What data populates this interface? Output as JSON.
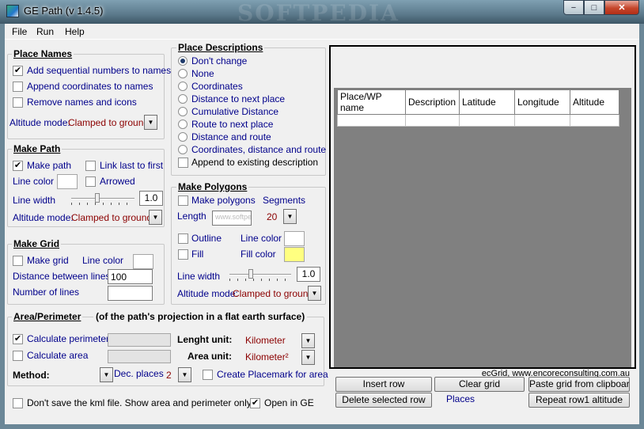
{
  "window": {
    "title": "GE Path (v 1.4.5)",
    "watermark": "SOFTPEDIA",
    "min": "−",
    "max": "□",
    "close": "✕"
  },
  "menu": [
    "File",
    "Run",
    "Help"
  ],
  "place_names": {
    "title": "Place Names",
    "sequential": "Add sequential numbers to names",
    "append_coords": "Append coordinates to names",
    "remove": "Remove names and icons",
    "alt_label": "Altitude mode:",
    "alt_value": "Clamped to ground"
  },
  "make_path": {
    "title": "Make Path",
    "make_path": "Make path",
    "link_last": "Link last to first",
    "line_color": "Line color",
    "arrowed": "Arrowed",
    "line_width": "Line width",
    "width_value": "1.0",
    "alt_label": "Altitude mode:",
    "alt_value": "Clamped to ground"
  },
  "make_grid": {
    "title": "Make Grid",
    "make_grid": "Make grid",
    "line_color": "Line color",
    "distance": "Distance between lines",
    "distance_value": "100",
    "number": "Number of  lines"
  },
  "area": {
    "title": "Area/Perimeter",
    "subtitle": "(of the path's projection in a flat earth surface)",
    "calc_perimeter": "Calculate perimeter",
    "calc_area": "Calculate area",
    "length_unit_label": "Lenght unit:",
    "length_unit": "Kilometer",
    "area_unit_label": "Area unit:",
    "area_unit": "Kilometer²",
    "method": "Method:",
    "dec_places": "Dec. places",
    "dec_value": "2",
    "create_placemark": "Create Placemark for area"
  },
  "bottom": {
    "dont_save": "Don't save the kml file. Show area and perimeter only",
    "open_ge": "Open in GE"
  },
  "place_desc": {
    "title": "Place Descriptions",
    "options": [
      "Don't change",
      "None",
      "Coordinates",
      "Distance to next place",
      "Cumulative Distance",
      "Route to next place",
      "Distance and route",
      "Coordinates, distance and route"
    ],
    "append": "Append to existing description"
  },
  "make_polygons": {
    "title": "Make Polygons",
    "make": "Make polygons",
    "segments": "Segments",
    "length": "Length",
    "seg_value": "20",
    "length_watermark": "www.softpedia.com",
    "outline": "Outline",
    "line_color": "Line color",
    "fill": "Fill",
    "fill_color": "Fill color",
    "line_width": "Line width",
    "width_value": "1.0",
    "alt_label": "Altitude mode:",
    "alt_value": "Clamped to ground"
  },
  "grid": {
    "columns": [
      "Place/WP name",
      "Description",
      "Latitude",
      "Longitude",
      "Altitude"
    ]
  },
  "status_text": "ecGrid,  www.encoreconsulting.com.au",
  "buttons": {
    "insert": "Insert row",
    "clear": "Clear grid",
    "paste": "Paste grid from clipboard",
    "delete": "Delete selected row",
    "places": "Places",
    "repeat": "Repeat row1 altitude"
  },
  "colors": {
    "label": "#00008b",
    "value": "#8b0000",
    "fill_yellow": "#ffff80"
  }
}
